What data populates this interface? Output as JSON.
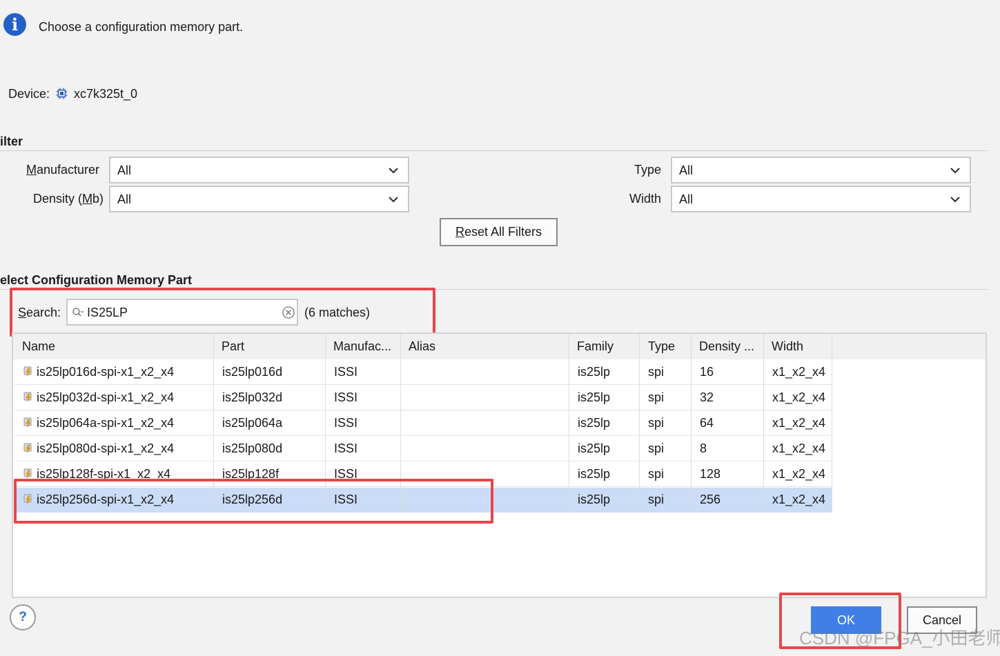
{
  "info": {
    "icon": "info-icon",
    "message": "Choose a configuration memory part."
  },
  "device": {
    "label": "Device:",
    "icon": "chip-icon",
    "value": "xc7k325t_0"
  },
  "filter": {
    "title": "ilter",
    "manufacturer_label": "Manufacturer",
    "manufacturer_value": "All",
    "density_label": "Density (Mb)",
    "density_value": "All",
    "type_label": "Type",
    "type_value": "All",
    "width_label": "Width",
    "width_value": "All",
    "reset_button": "Reset All Filters"
  },
  "select": {
    "title": "elect Configuration Memory Part",
    "search_label": "Search:",
    "search_value": "IS25LP",
    "match_count": "(6 matches)"
  },
  "table": {
    "columns": [
      "Name",
      "Part",
      "Manufac...",
      "Alias",
      "Family",
      "Type",
      "Density ...",
      "Width"
    ],
    "rows": [
      {
        "name": "is25lp016d-spi-x1_x2_x4",
        "part": "is25lp016d",
        "manufacturer": "ISSI",
        "alias": "",
        "family": "is25lp",
        "type": "spi",
        "density": "16",
        "width": "x1_x2_x4"
      },
      {
        "name": "is25lp032d-spi-x1_x2_x4",
        "part": "is25lp032d",
        "manufacturer": "ISSI",
        "alias": "",
        "family": "is25lp",
        "type": "spi",
        "density": "32",
        "width": "x1_x2_x4"
      },
      {
        "name": "is25lp064a-spi-x1_x2_x4",
        "part": "is25lp064a",
        "manufacturer": "ISSI",
        "alias": "",
        "family": "is25lp",
        "type": "spi",
        "density": "64",
        "width": "x1_x2_x4"
      },
      {
        "name": "is25lp080d-spi-x1_x2_x4",
        "part": "is25lp080d",
        "manufacturer": "ISSI",
        "alias": "",
        "family": "is25lp",
        "type": "spi",
        "density": "8",
        "width": "x1_x2_x4"
      },
      {
        "name": "is25lp128f-spi-x1_x2_x4",
        "part": "is25lp128f",
        "manufacturer": "ISSI",
        "alias": "",
        "family": "is25lp",
        "type": "spi",
        "density": "128",
        "width": "x1_x2_x4"
      },
      {
        "name": "is25lp256d-spi-x1_x2_x4",
        "part": "is25lp256d",
        "manufacturer": "ISSI",
        "alias": "",
        "family": "is25lp",
        "type": "spi",
        "density": "256",
        "width": "x1_x2_x4",
        "selected": true
      }
    ]
  },
  "footer": {
    "help_label": "?",
    "ok_label": "OK",
    "cancel_label": "Cancel"
  },
  "watermark": "CSDN @FPGA_小田老师",
  "colors": {
    "accent": "#3f7fe6",
    "highlight": "#e8454b",
    "selection": "#cbdcf6",
    "info": "#2361c7"
  }
}
